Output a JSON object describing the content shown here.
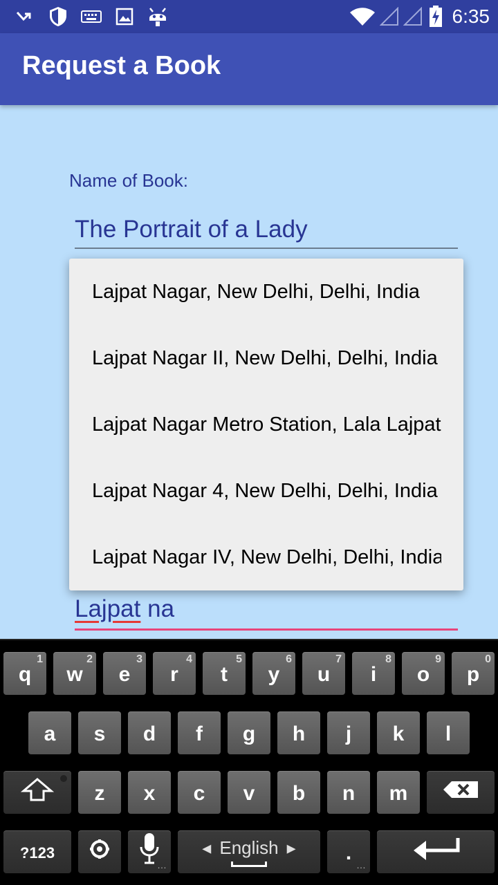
{
  "status_bar": {
    "icons": [
      "missed-call-icon",
      "shield-icon",
      "keyboard-icon",
      "image-icon",
      "android-icon",
      "wifi-icon",
      "signal-icon",
      "signal-icon",
      "battery-charging-icon"
    ],
    "time": "6:35"
  },
  "app_bar": {
    "title": "Request a Book"
  },
  "form": {
    "book_label": "Name of Book:",
    "book_value": "The Portrait of a Lady",
    "location_value_word1": "Lajpat",
    "location_value_word2": " na"
  },
  "suggestions": [
    "Lajpat Nagar, New Delhi, Delhi, India",
    "Lajpat Nagar II, New Delhi, Delhi, India",
    "Lajpat Nagar Metro Station, Lala Lajpat Rai Marg",
    "Lajpat Nagar 4, New Delhi, Delhi, India",
    "Lajpat Nagar IV, New Delhi, Delhi, India"
  ],
  "keyboard": {
    "row1": [
      {
        "key": "q",
        "hint": "1"
      },
      {
        "key": "w",
        "hint": "2"
      },
      {
        "key": "e",
        "hint": "3"
      },
      {
        "key": "r",
        "hint": "4"
      },
      {
        "key": "t",
        "hint": "5"
      },
      {
        "key": "y",
        "hint": "6"
      },
      {
        "key": "u",
        "hint": "7"
      },
      {
        "key": "i",
        "hint": "8"
      },
      {
        "key": "o",
        "hint": "9"
      },
      {
        "key": "p",
        "hint": "0"
      }
    ],
    "row2": [
      "a",
      "s",
      "d",
      "f",
      "g",
      "h",
      "j",
      "k",
      "l"
    ],
    "row3": [
      "z",
      "x",
      "c",
      "v",
      "b",
      "n",
      "m"
    ],
    "symbols_label": "?123",
    "space_label": "English",
    "period_label": ".",
    "colors": {
      "key": "#606060",
      "dark_key": "#333333",
      "background": "#000000"
    }
  },
  "colors": {
    "primary": "#3f51b5",
    "primary_dark": "#303f9f",
    "background": "#bbdefb",
    "accent": "#e8437a",
    "text": "#283593"
  }
}
